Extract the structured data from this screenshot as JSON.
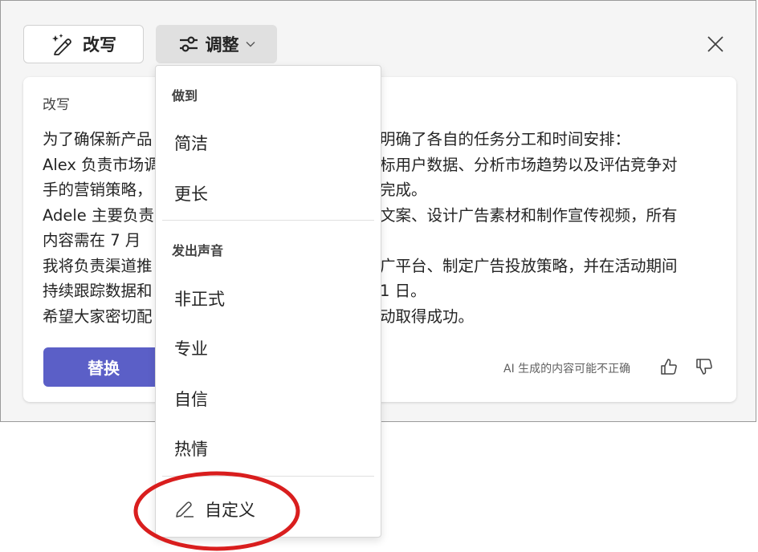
{
  "toolbar": {
    "rewrite_label": "改写",
    "adjust_label": "调整",
    "adjust_chevron": "⌵"
  },
  "card": {
    "label": "改写",
    "lines": [
      "为了确保新产品",
      "Alex 负责市场调",
      "手的营销策略，",
      "Adele 主要负责",
      "内容需在 7 月",
      "我将负责渠道推",
      "持续跟踪数据和",
      "希望大家密切配"
    ],
    "lines_right": [
      "明确了各自的任务分工和时间安排：",
      "标用户数据、分析市场趋势以及评估竞争对",
      "完成。",
      "文案、设计广告素材和制作宣传视频，所有",
      "",
      "广平台、制定广告投放策略，并在活动期间",
      "1 日。",
      "动取得成功。"
    ],
    "replace_label": "替换",
    "disclaimer": "AI 生成的内容可能不正确"
  },
  "menu": {
    "section1_header": "做到",
    "concise": "简洁",
    "longer": "更长",
    "section2_header": "发出声音",
    "informal": "非正式",
    "professional": "专业",
    "confident": "自信",
    "enthusiastic": "热情",
    "custom": "自定义"
  },
  "colors": {
    "accent": "#5b5fc7",
    "highlight_oval": "#d91e1e"
  }
}
